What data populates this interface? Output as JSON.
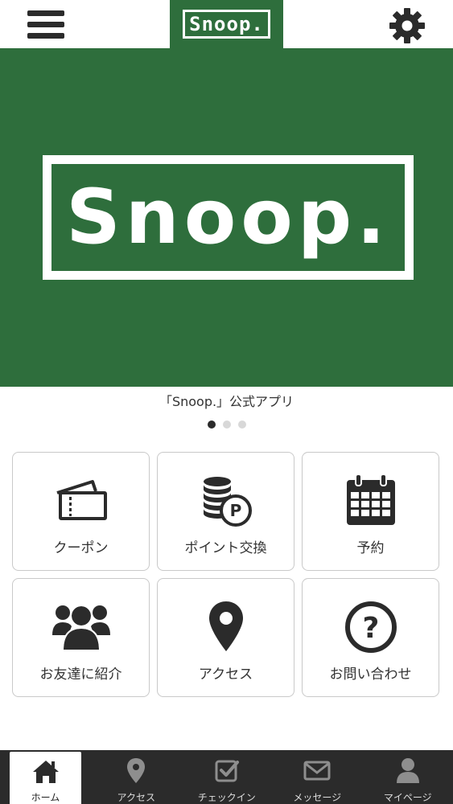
{
  "header": {
    "logo_text": "Snoop.",
    "menu_icon": "hamburger-menu-icon",
    "settings_icon": "gear-icon"
  },
  "hero": {
    "logo_text": "Snoop.",
    "caption": "「Snoop.」公式アプリ",
    "slides_total": 3,
    "active_slide": 1
  },
  "tiles": [
    {
      "label": "クーポン",
      "icon": "ticket-icon"
    },
    {
      "label": "ポイント交換",
      "icon": "coins-point-icon"
    },
    {
      "label": "予約",
      "icon": "calendar-icon"
    },
    {
      "label": "お友達に紹介",
      "icon": "people-icon"
    },
    {
      "label": "アクセス",
      "icon": "map-pin-icon"
    },
    {
      "label": "お問い合わせ",
      "icon": "question-circle-icon"
    }
  ],
  "bottom_nav": [
    {
      "label": "ホーム",
      "icon": "home-icon",
      "active": true
    },
    {
      "label": "アクセス",
      "icon": "map-pin-icon",
      "active": false
    },
    {
      "label": "チェックイン",
      "icon": "checkbox-icon",
      "active": false
    },
    {
      "label": "メッセージ",
      "icon": "envelope-icon",
      "active": false
    },
    {
      "label": "マイページ",
      "icon": "user-icon",
      "active": false
    }
  ],
  "colors": {
    "brand_green": "#2e6e3c",
    "dark": "#2b2b2b",
    "tile_border": "#c9c9c9"
  }
}
